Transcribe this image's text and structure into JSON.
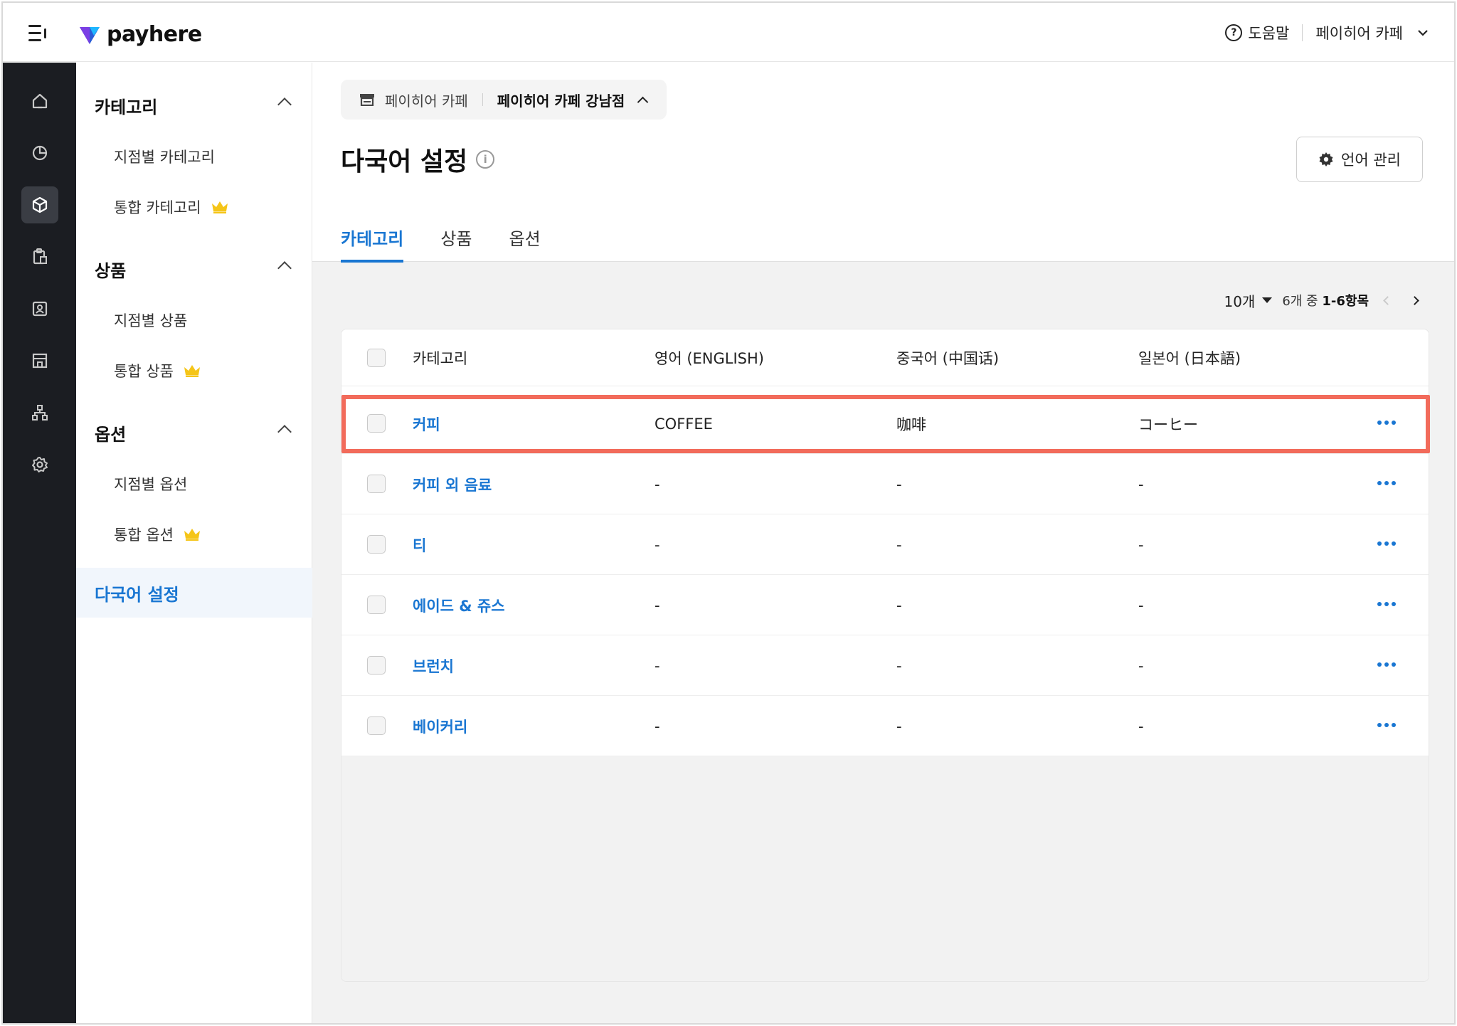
{
  "header": {
    "brand": "payhere",
    "help_label": "도움말",
    "help_icon_glyph": "?",
    "store_selector": "페이히어 카페"
  },
  "rail": {
    "items": [
      "home-icon",
      "analytics-icon",
      "product-box-icon",
      "clipboard-icon",
      "customer-icon",
      "store-icon",
      "org-chart-icon",
      "settings-icon"
    ],
    "active": "product-box-icon"
  },
  "sidebar": {
    "groups": [
      {
        "label": "카테고리",
        "items": [
          {
            "label": "지점별 카테고리"
          },
          {
            "label": "통합 카테고리"
          }
        ]
      },
      {
        "label": "상품",
        "items": [
          {
            "label": "지점별 상품"
          },
          {
            "label": "통합 상품"
          }
        ]
      },
      {
        "label": "옵션",
        "items": [
          {
            "label": "지점별 옵션"
          },
          {
            "label": "통합 옵션"
          }
        ]
      }
    ],
    "active_item": "다국어 설정",
    "crown_color": "#f5c518"
  },
  "main": {
    "breadcrumb": {
      "brand": "페이히어 카페",
      "store": "페이히어 카페 강남점"
    },
    "title": "다국어 설정",
    "info_glyph": "i",
    "lang_button": "언어 관리",
    "tabs": [
      {
        "label": "카테고리"
      },
      {
        "label": "상품"
      },
      {
        "label": "옵션"
      }
    ],
    "active_tab": "카테고리",
    "pager": {
      "page_size": "10개",
      "range_prefix": "6개 중",
      "range": "1-6항목"
    },
    "table": {
      "columns": [
        "카테고리",
        "영어 (ENGLISH)",
        "중국어 (中国话)",
        "일본어 (日本語)"
      ],
      "rows": [
        {
          "name": "커피",
          "en": "COFFEE",
          "zh": "咖啡",
          "ja": "コーヒー",
          "highlighted": true
        },
        {
          "name": "커피 외 음료",
          "en": "-",
          "zh": "-",
          "ja": "-"
        },
        {
          "name": "티",
          "en": "-",
          "zh": "-",
          "ja": "-"
        },
        {
          "name": "에이드 & 쥬스",
          "en": "-",
          "zh": "-",
          "ja": "-"
        },
        {
          "name": "브런치",
          "en": "-",
          "zh": "-",
          "ja": "-"
        },
        {
          "name": "베이커리",
          "en": "-",
          "zh": "-",
          "ja": "-"
        }
      ]
    }
  },
  "colors": {
    "accent": "#1976d2",
    "highlight": "#f26b5b",
    "rail_bg": "#1b1d22"
  }
}
